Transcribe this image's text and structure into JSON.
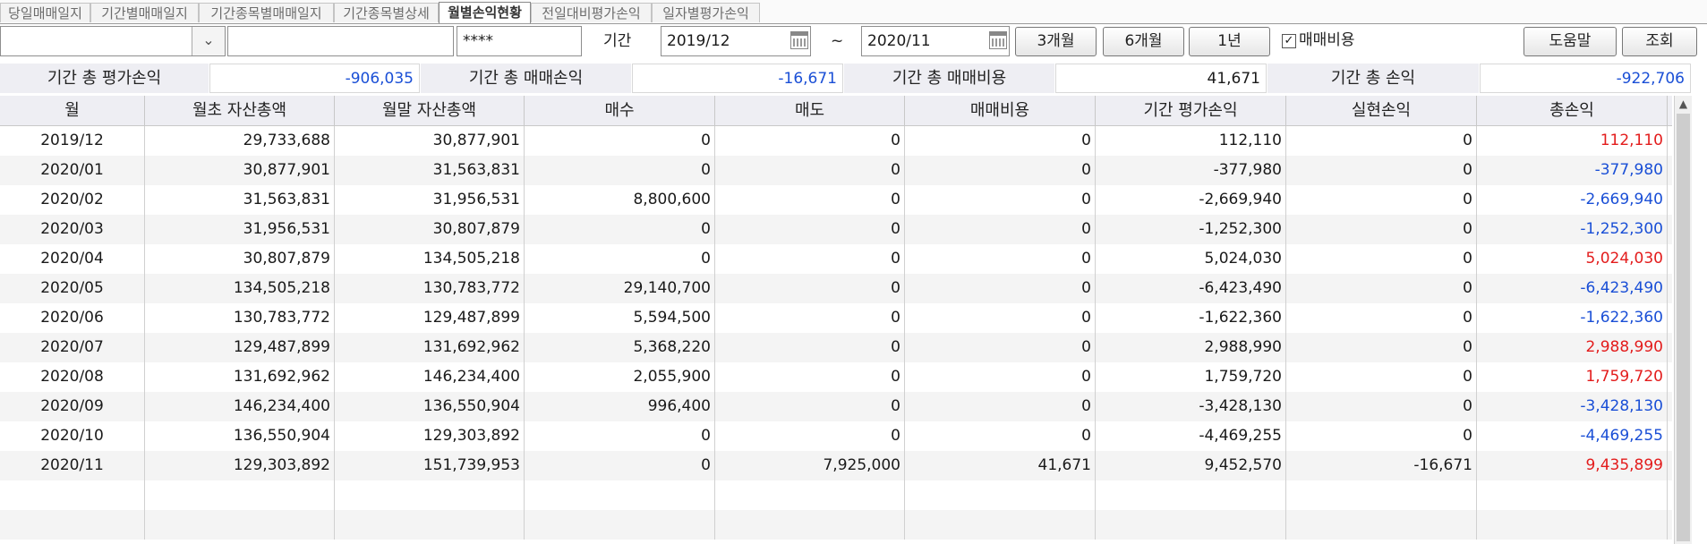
{
  "tabs": [
    {
      "label": "당일매매일지",
      "active": false
    },
    {
      "label": "기간별매매일지",
      "active": false
    },
    {
      "label": "기간종목별매매일지",
      "active": false
    },
    {
      "label": "기간종목별상세",
      "active": false
    },
    {
      "label": "월별손익현황",
      "active": true
    },
    {
      "label": "전일대비평가손익",
      "active": false
    },
    {
      "label": "일자별평가손익",
      "active": false
    }
  ],
  "toolbar": {
    "account_value": "",
    "name_value": "",
    "password_value": "****",
    "period_label": "기간",
    "start_date": "2019/12",
    "tilde": "~",
    "end_date": "2020/11",
    "btn_3m": "3개월",
    "btn_6m": "6개월",
    "btn_1y": "1년",
    "include_fee_checked": "☑",
    "include_fee_label": "매매비용",
    "help_label": "도움말",
    "search_label": "조회"
  },
  "summary": {
    "eval_label": "기간 총 평가손익",
    "eval_value": "-906,035",
    "trade_label": "기간 총 매매손익",
    "trade_value": "-16,671",
    "fee_label": "기간 총 매매비용",
    "fee_value": "41,671",
    "total_label": "기간 총 손익",
    "total_value": "-922,706"
  },
  "table": {
    "headers": [
      "월",
      "월초 자산총액",
      "월말 자산총액",
      "매수",
      "매도",
      "매매비용",
      "기간 평가손익",
      "실현손익",
      "총손익"
    ],
    "rows": [
      [
        "2019/12",
        "29,733,688",
        "30,877,901",
        "0",
        "0",
        "0",
        "112,110",
        "0",
        "112,110"
      ],
      [
        "2020/01",
        "30,877,901",
        "31,563,831",
        "0",
        "0",
        "0",
        "-377,980",
        "0",
        "-377,980"
      ],
      [
        "2020/02",
        "31,563,831",
        "31,956,531",
        "8,800,600",
        "0",
        "0",
        "-2,669,940",
        "0",
        "-2,669,940"
      ],
      [
        "2020/03",
        "31,956,531",
        "30,807,879",
        "0",
        "0",
        "0",
        "-1,252,300",
        "0",
        "-1,252,300"
      ],
      [
        "2020/04",
        "30,807,879",
        "134,505,218",
        "0",
        "0",
        "0",
        "5,024,030",
        "0",
        "5,024,030"
      ],
      [
        "2020/05",
        "134,505,218",
        "130,783,772",
        "29,140,700",
        "0",
        "0",
        "-6,423,490",
        "0",
        "-6,423,490"
      ],
      [
        "2020/06",
        "130,783,772",
        "129,487,899",
        "5,594,500",
        "0",
        "0",
        "-1,622,360",
        "0",
        "-1,622,360"
      ],
      [
        "2020/07",
        "129,487,899",
        "131,692,962",
        "5,368,220",
        "0",
        "0",
        "2,988,990",
        "0",
        "2,988,990"
      ],
      [
        "2020/08",
        "131,692,962",
        "146,234,400",
        "2,055,900",
        "0",
        "0",
        "1,759,720",
        "0",
        "1,759,720"
      ],
      [
        "2020/09",
        "146,234,400",
        "136,550,904",
        "996,400",
        "0",
        "0",
        "-3,428,130",
        "0",
        "-3,428,130"
      ],
      [
        "2020/10",
        "136,550,904",
        "129,303,892",
        "0",
        "0",
        "0",
        "-4,469,255",
        "0",
        "-4,469,255"
      ],
      [
        "2020/11",
        "129,303,892",
        "151,739,953",
        "0",
        "7,925,000",
        "41,671",
        "9,452,570",
        "-16,671",
        "9,435,899"
      ]
    ]
  },
  "colors": {
    "negative": "#1a4fd6",
    "positive": "#e31c1c",
    "header_bg": "#eeeef3"
  },
  "icons": {
    "combo": "chevron-down-icon",
    "calendar": "calendar-icon",
    "check": "checkbox-checked-icon"
  }
}
